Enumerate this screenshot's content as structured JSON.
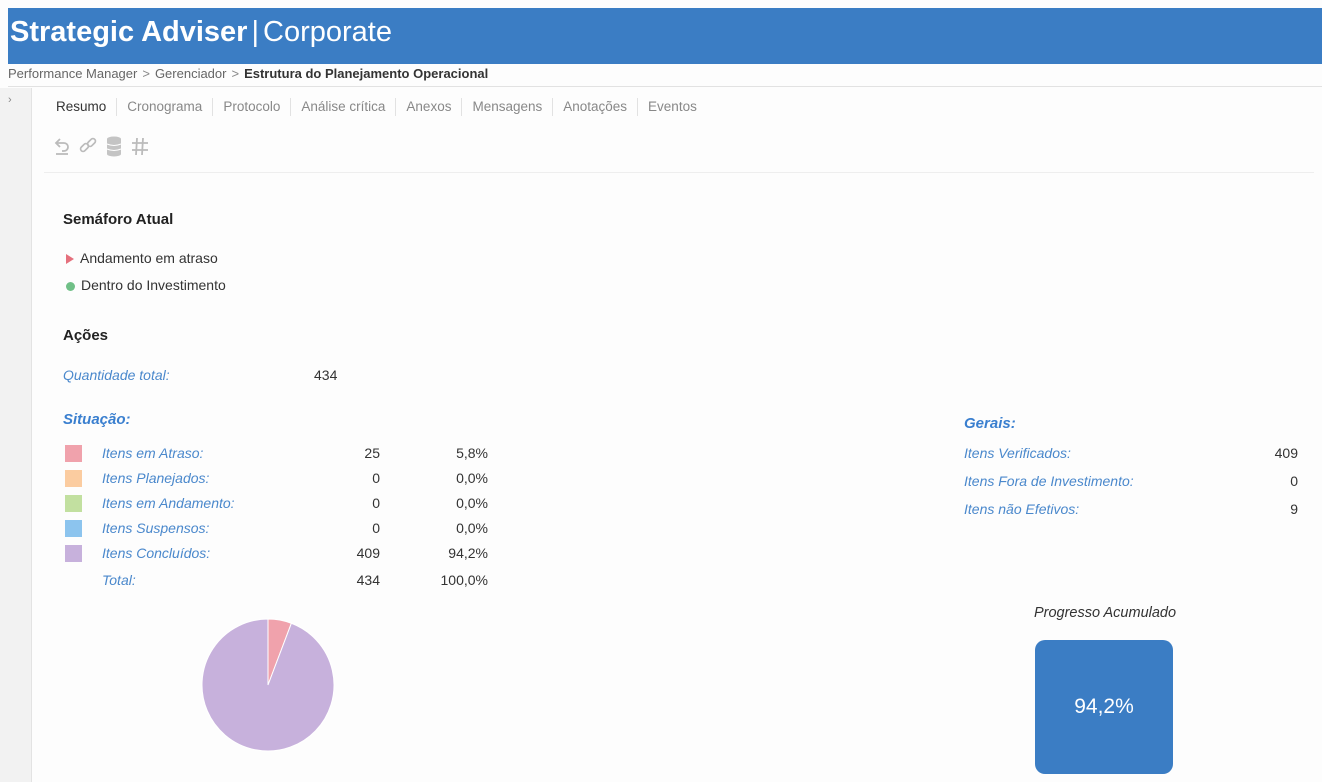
{
  "header": {
    "brand": "Strategic Adviser",
    "separator": "|",
    "product": "Corporate",
    "color": "#3b7dc4"
  },
  "breadcrumb": [
    "Performance Manager",
    "Gerenciador",
    "Estrutura do Planejamento Operacional"
  ],
  "breadcrumb_separator": ">",
  "sidebar": {
    "expand_glyph": "›"
  },
  "tabs": [
    "Resumo",
    "Cronograma",
    "Protocolo",
    "Análise crítica",
    "Anexos",
    "Mensagens",
    "Anotações",
    "Eventos"
  ],
  "active_tab": "Resumo",
  "toolbar": [
    "undo-icon",
    "link-icon",
    "database-icon",
    "hash-icon"
  ],
  "semaforo": {
    "title": "Semáforo Atual",
    "items": [
      {
        "label": "Andamento em atraso",
        "marker": "triangle",
        "color": "#e5707d"
      },
      {
        "label": "Dentro do Investimento",
        "marker": "circle",
        "color": "#70c087"
      }
    ]
  },
  "acoes": {
    "title": "Ações",
    "quantidade_label": "Quantidade total:",
    "quantidade": "434"
  },
  "situacao": {
    "title": "Situação:",
    "rows": [
      {
        "label": "Itens em Atraso:",
        "count": "25",
        "percent": "5,8%",
        "color": "#f0a2ac"
      },
      {
        "label": "Itens Planejados:",
        "count": "0",
        "percent": "0,0%",
        "color": "#fbcca0"
      },
      {
        "label": "Itens em Andamento:",
        "count": "0",
        "percent": "0,0%",
        "color": "#c2e0a0"
      },
      {
        "label": "Itens Suspensos:",
        "count": "0",
        "percent": "0,0%",
        "color": "#8cc4ee"
      },
      {
        "label": "Itens Concluídos:",
        "count": "409",
        "percent": "94,2%",
        "color": "#c7b1dc"
      }
    ],
    "total": {
      "label": "Total:",
      "count": "434",
      "percent": "100,0%"
    }
  },
  "gerais": {
    "title": "Gerais:",
    "rows": [
      {
        "label": "Itens Verificados:",
        "value": "409"
      },
      {
        "label": "Itens Fora de Investimento:",
        "value": "0"
      },
      {
        "label": "Itens não Efetivos:",
        "value": "9"
      }
    ]
  },
  "progresso": {
    "title": "Progresso Acumulado",
    "value": "94,2%",
    "fraction": 0.942
  },
  "chart_data": {
    "type": "pie",
    "categories": [
      "Itens em Atraso",
      "Itens Planejados",
      "Itens em Andamento",
      "Itens Suspensos",
      "Itens Concluídos"
    ],
    "values": [
      25,
      0,
      0,
      0,
      409
    ],
    "colors": [
      "#f0a2ac",
      "#fbcca0",
      "#c2e0a0",
      "#8cc4ee",
      "#c7b1dc"
    ]
  }
}
